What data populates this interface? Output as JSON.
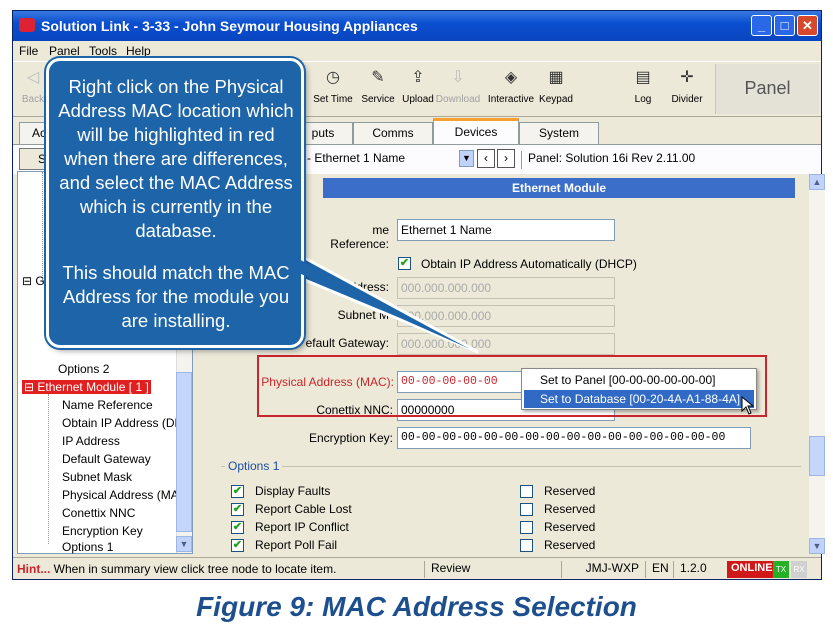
{
  "window": {
    "title": "Solution Link - 3-33 - John Seymour Housing Appliances",
    "controls": {
      "minimize": "_",
      "maximize": "□",
      "close": "✕"
    }
  },
  "menu": [
    "File",
    "Panel",
    "Tools",
    "Help"
  ],
  "toolbar": {
    "items": [
      {
        "label": "Back",
        "icon": "back-arrow-icon",
        "glyph": "◁",
        "disabled": true
      },
      {
        "label": "Set Time",
        "icon": "clock-icon",
        "glyph": "◷"
      },
      {
        "label": "Service",
        "icon": "wrench-icon",
        "glyph": "✎"
      },
      {
        "label": "Upload",
        "icon": "upload-icon",
        "glyph": "⇪"
      },
      {
        "label": "Download",
        "icon": "download-icon",
        "glyph": "⇩",
        "disabled": true
      },
      {
        "label": "Interactive",
        "icon": "interactive-icon",
        "glyph": "◈"
      },
      {
        "label": "Keypad",
        "icon": "keypad-icon",
        "glyph": "▦"
      },
      {
        "label": "Log",
        "icon": "log-icon",
        "glyph": "▤"
      },
      {
        "label": "Divider",
        "icon": "divider-icon",
        "glyph": "✛"
      }
    ],
    "panel_label": "Panel"
  },
  "tabs": [
    "Ac",
    "puts",
    "Comms",
    "Devices",
    "System"
  ],
  "active_tab": "Devices",
  "subbar": {
    "summary_button": "Su",
    "device_select": "- Ethernet 1 Name",
    "panel_info": "Panel:  Solution 16i Rev 2.11.00"
  },
  "tree": {
    "items": [
      {
        "label": "G",
        "depth": 0,
        "expander": "⊟"
      },
      {
        "label": "Options 2",
        "depth": 1
      },
      {
        "label": "Ethernet Module [ 1 ]",
        "depth": 0,
        "expander": "⊟",
        "selected": true
      },
      {
        "label": "Name Reference",
        "depth": 1
      },
      {
        "label": "Obtain IP Address (DH",
        "depth": 1
      },
      {
        "label": "IP Address",
        "depth": 1
      },
      {
        "label": "Default Gateway",
        "depth": 1
      },
      {
        "label": "Subnet Mask",
        "depth": 1
      },
      {
        "label": "Physical Address (MAC",
        "depth": 1
      },
      {
        "label": "Conettix NNC",
        "depth": 1
      },
      {
        "label": "Encryption Key",
        "depth": 1
      },
      {
        "label": "Options 1",
        "depth": 1
      }
    ]
  },
  "form": {
    "section_title": "Ethernet Module",
    "name_reference_label": "me Reference:",
    "name_reference_value": "Ethernet 1 Name",
    "dhcp_label": "Obtain IP Address Automatically (DHCP)",
    "dhcp_checked": true,
    "ip_label": "ddress:",
    "ip_value": "000.000.000.000",
    "subnet_label": "Subnet M",
    "subnet_value": "000.000.000.000",
    "gateway_label": "efault Gateway:",
    "gateway_value": "000.000.000.000",
    "mac_label": "Physical Address (MAC):",
    "mac_value": "00-00-00-00-00",
    "nnc_label": "Conettix NNC:",
    "nnc_value": "00000000",
    "enc_label": "Encryption Key:",
    "enc_value": "00-00-00-00-00-00-00-00-00-00-00-00-00-00-00-00",
    "options_group": "Options 1",
    "options": [
      {
        "label": "Display Faults",
        "checked": true
      },
      {
        "label": "Report Cable Lost",
        "checked": true
      },
      {
        "label": "Report IP Conflict",
        "checked": true
      },
      {
        "label": "Report Poll Fail",
        "checked": true
      }
    ],
    "reserved": [
      {
        "label": "Reserved",
        "checked": false
      },
      {
        "label": "Reserved",
        "checked": false
      },
      {
        "label": "Reserved",
        "checked": false
      },
      {
        "label": "Reserved",
        "checked": false
      }
    ]
  },
  "context_menu": {
    "items": [
      {
        "label": "Set to Panel [00-00-00-00-00-00]",
        "highlighted": false
      },
      {
        "label": "Set to Database [00-20-4A-A1-88-4A]",
        "highlighted": true
      }
    ]
  },
  "status": {
    "hint_label": "Hint...",
    "hint_text": " When in summary view click tree node to locate item.",
    "review": "Review",
    "machine": "JMJ-WXP",
    "lang": "EN",
    "version": "1.2.0",
    "online": "ONLINE",
    "tx": "TX",
    "rx": "RX"
  },
  "callout": {
    "text1": "Right click on the Physical Address MAC location which will be highlighted in red when there are differences, and select the MAC Address which is currently in the database.",
    "text2": "This should match the MAC Address for the module you are installing."
  },
  "caption": "Figure 9: MAC Address Selection",
  "colors": {
    "highlight": "#c8262c",
    "callout": "#1d64a8",
    "title_bar": "#0a4fd0",
    "online": "#d01818"
  }
}
